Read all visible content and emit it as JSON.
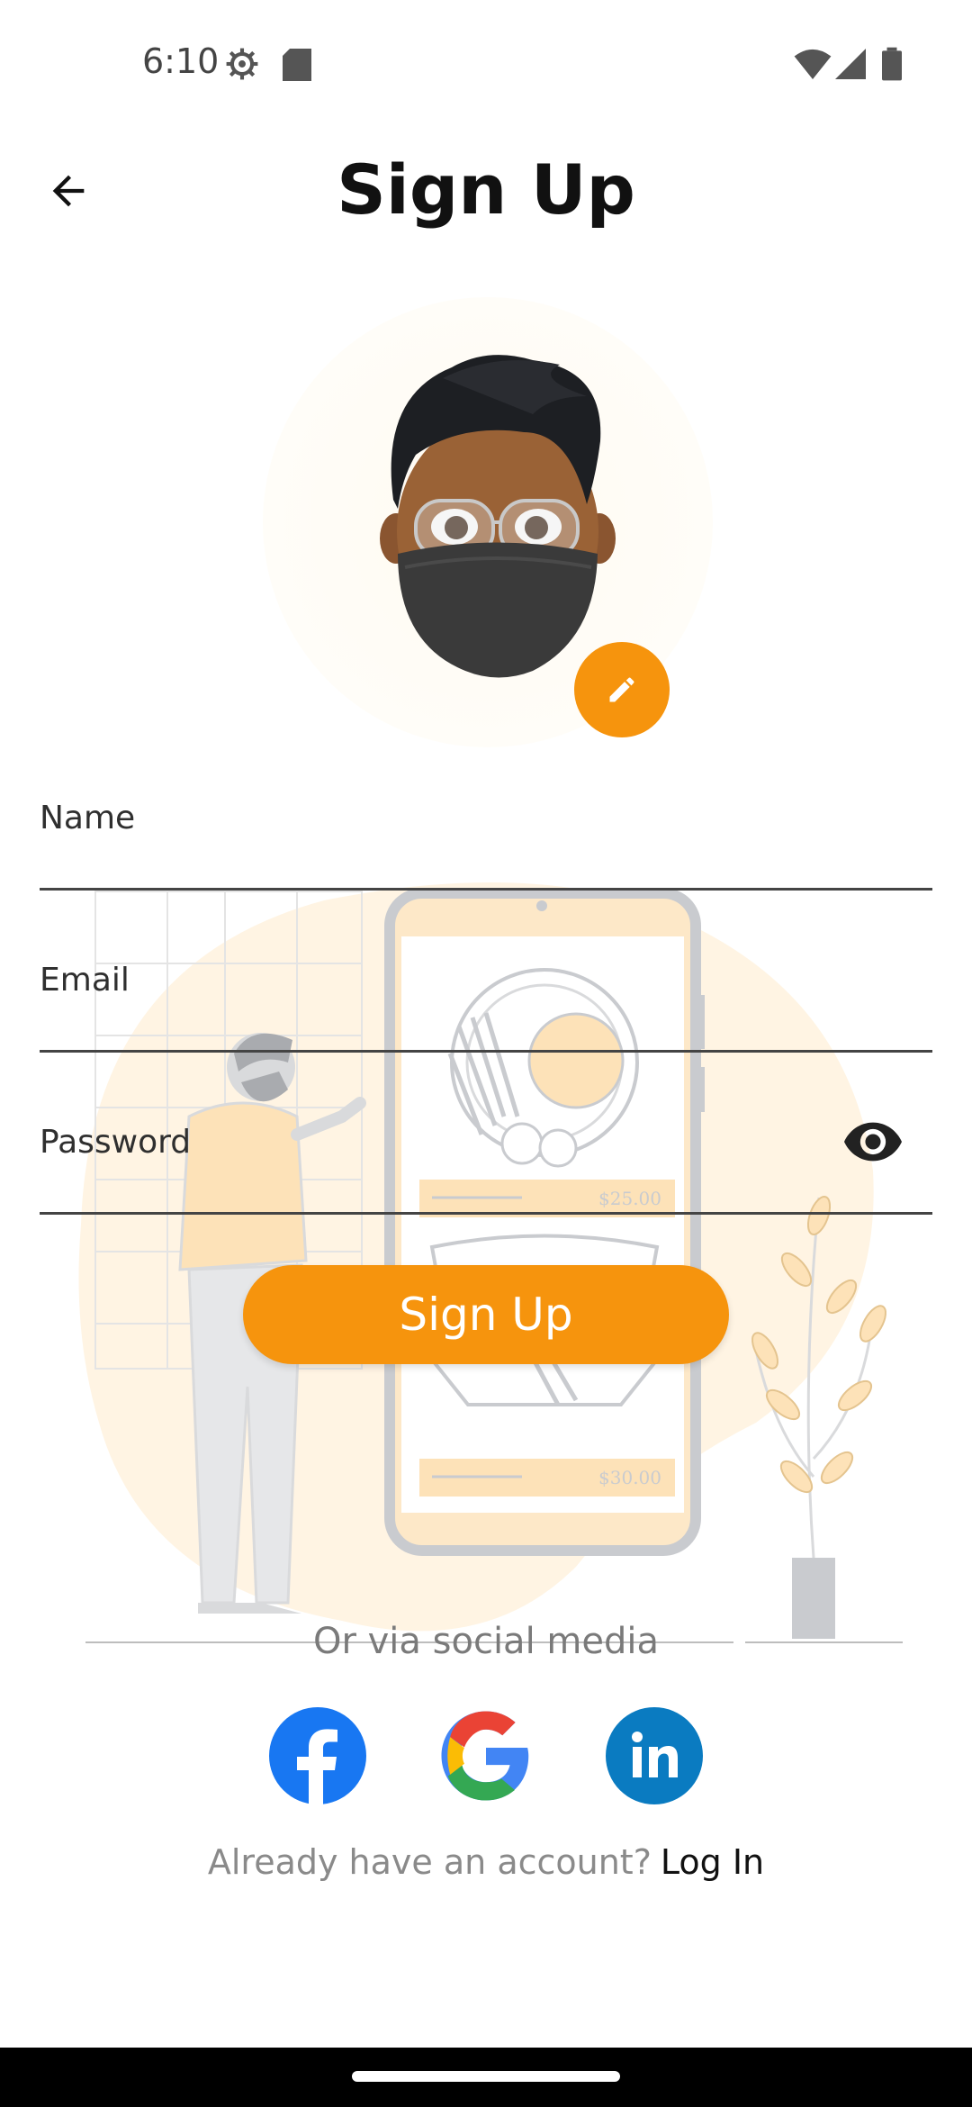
{
  "status_bar": {
    "time": "6:10",
    "icons": [
      "settings-gear-icon",
      "sd-card-icon",
      "wifi-icon",
      "cell-signal-icon",
      "battery-icon"
    ]
  },
  "header": {
    "title": "Sign Up",
    "back_icon": "arrow-left-icon"
  },
  "avatar": {
    "edit_icon": "pencil-icon"
  },
  "form": {
    "name_label": "Name",
    "email_label": "Email",
    "password_label": "Password",
    "password_toggle_icon": "eye-icon",
    "submit_label": "Sign Up"
  },
  "illustration": {
    "price_1": "$25.00",
    "price_2": "$30.00"
  },
  "social": {
    "label": "Or via social media",
    "providers": [
      "facebook",
      "google",
      "linkedin"
    ]
  },
  "footer": {
    "prompt": "Already have an account?",
    "login_label": "Log In"
  },
  "colors": {
    "accent": "#f6940d",
    "facebook": "#1877f2",
    "linkedin": "#0a7bc1"
  }
}
